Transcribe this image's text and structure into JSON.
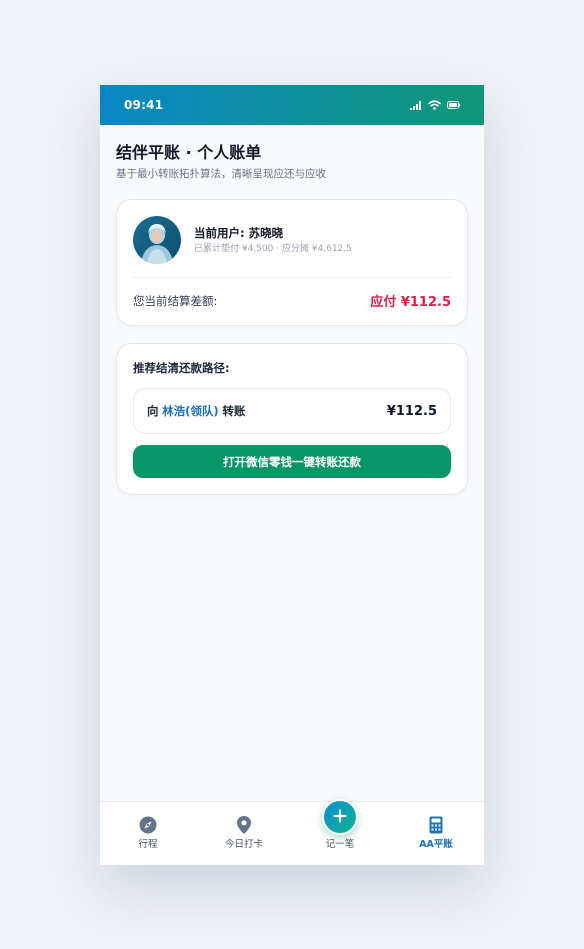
{
  "status_bar": {
    "time": "09:41",
    "icons": [
      "signal-icon",
      "wifi-icon",
      "battery-icon"
    ]
  },
  "header": {
    "title": "结伴平账 · 个人账单",
    "subtitle": "基于最小转账拓扑算法，清晰呈现应还与应收"
  },
  "user_card": {
    "name_line": "当前用户: 苏晓晓",
    "meta_line": "已累计垫付 ¥4,500 · 应分摊 ¥4,612.5",
    "balance_label": "您当前结算差额:",
    "balance_value": "应付 ¥112.5"
  },
  "settlement": {
    "title": "推荐结清还款路径:",
    "route_prefix": "向",
    "route_target": "林浩(领队)",
    "route_suffix": "转账",
    "route_amount": "¥112.5",
    "action_label": "打开微信零钱一键转账还款"
  },
  "tab_bar": {
    "items": [
      {
        "label": "行程",
        "icon": "compass-icon"
      },
      {
        "label": "今日打卡",
        "icon": "location-pin-icon"
      },
      {
        "label": "记一笔",
        "icon": "plus-icon"
      },
      {
        "label": "AA平账",
        "icon": "calculator-icon",
        "active": true
      }
    ]
  },
  "colors": {
    "brand_gradient_start": "#0a86c4",
    "brand_gradient_end": "#0e9877",
    "payable_red": "#e11d48",
    "action_green": "#079667",
    "active_tab_blue": "#1d72b8"
  }
}
